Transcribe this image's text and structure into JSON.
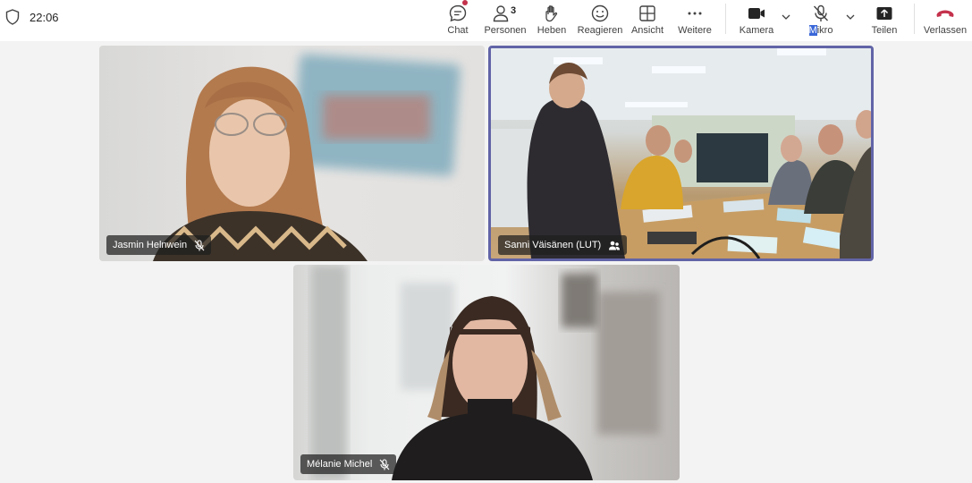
{
  "status": {
    "time": "22:06",
    "shield_icon": "shield-icon"
  },
  "toolbar": {
    "chat": {
      "label": "Chat",
      "icon": "chat-icon",
      "badge_color": "#c4314b"
    },
    "people": {
      "label": "Personen",
      "count": "3",
      "icon": "people-icon"
    },
    "raise": {
      "label": "Heben",
      "icon": "hand-icon"
    },
    "react": {
      "label": "Reagieren",
      "icon": "smiley-icon"
    },
    "view": {
      "label": "Ansicht",
      "icon": "grid-icon"
    },
    "more": {
      "label": "Weitere",
      "icon": "ellipsis-icon"
    },
    "camera": {
      "label": "Kamera",
      "icon": "camera-icon"
    },
    "mic": {
      "label_highlight": "M",
      "label_rest": "ikro",
      "icon": "mic-muted-icon"
    },
    "share": {
      "label": "Teilen",
      "icon": "share-icon"
    },
    "leave": {
      "label": "Verlassen",
      "icon": "hangup-icon",
      "color": "#c4314b"
    }
  },
  "participants": [
    {
      "name": "Jasmin Helnwein",
      "muted": true
    },
    {
      "name": "Sanni Väisänen (LUT)",
      "active_speaker": true
    },
    {
      "name": "Mélanie Michel",
      "muted": true
    }
  ],
  "colors": {
    "active_border": "#6264a7",
    "selection": "#3966d8"
  }
}
